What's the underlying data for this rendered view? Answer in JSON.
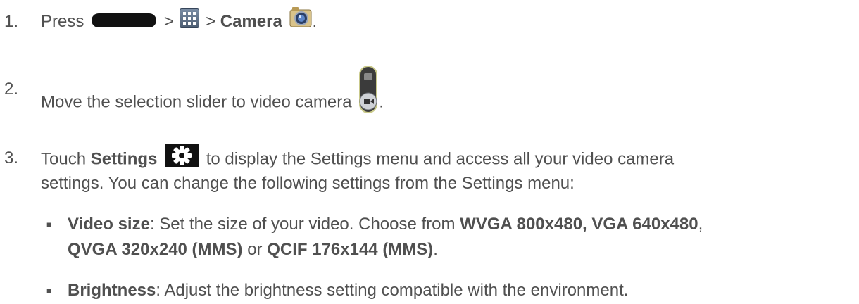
{
  "steps": [
    {
      "num": "1.",
      "press": "Press",
      "gt1": ">",
      "gt2": ">",
      "camera_label": "Camera",
      "period": "."
    },
    {
      "num": "2.",
      "text": "Move the selection slider to video camera",
      "period": "."
    },
    {
      "num": "3.",
      "touch": "Touch",
      "settings_label": "Settings",
      "text_after": "to display the Settings menu and access all your video camera",
      "line2": "settings. You can change the following settings from the Settings menu:"
    }
  ],
  "bullets": [
    {
      "marker": "■",
      "label": "Video size",
      "text1": ": Set the size of your video. Choose from ",
      "opt1": "WVGA 800x480, VGA 640x480",
      "comma": ",",
      "opt2": "QVGA 320x240 (MMS)",
      "or": " or ",
      "opt3": "QCIF 176x144 (MMS)",
      "end": "."
    },
    {
      "marker": "■",
      "label": "Brightness",
      "text1": ": Adjust the brightness setting compatible with the environment."
    }
  ],
  "icons": {
    "home_key": "home-key-icon",
    "apps": "apps-grid-icon",
    "camera": "camera-app-icon",
    "mode_slider": "video-mode-slider-icon",
    "settings": "settings-gear-icon"
  }
}
